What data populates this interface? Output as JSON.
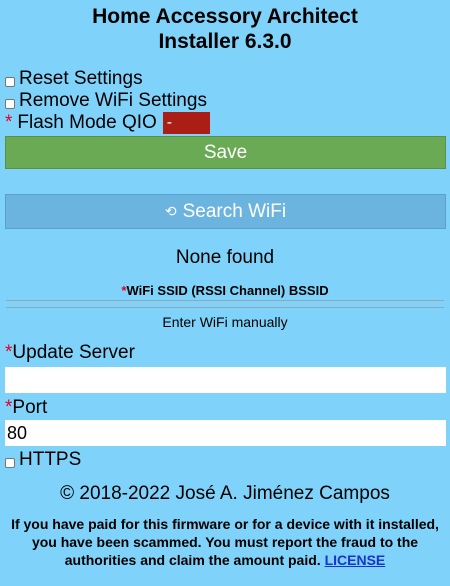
{
  "header": {
    "title_line1": "Home Accessory Architect",
    "title_line2": "Installer 6.3.0"
  },
  "options": {
    "reset_label": "Reset Settings",
    "remove_wifi_label": "Remove WiFi Settings",
    "flash_label": "Flash Mode QIO",
    "flash_value": "-",
    "required_mark": "*"
  },
  "buttons": {
    "save": "Save",
    "search_wifi": "Search WiFi"
  },
  "wifi": {
    "status": "None found",
    "table_header": "WiFi SSID (RSSI Channel) BSSID",
    "manual_link": "Enter WiFi manually"
  },
  "fields": {
    "update_server_label": "Update Server",
    "update_server_value": "",
    "port_label": "Port",
    "port_value": "80",
    "https_label": "HTTPS"
  },
  "footer": {
    "copyright": "© 2018-2022 José A. Jiménez Campos",
    "warning": "If you have paid for this firmware or for a device with it installed, you have been scammed. You must report the fraud to the authorities and claim the amount paid.",
    "license_link": "LICENSE"
  },
  "colors": {
    "background": "#7fd2f9",
    "save_button": "#6aaa54",
    "search_button": "#6bb4e0",
    "flash_select": "#aa1e15",
    "required": "#e4002b",
    "link": "#1a33cc"
  }
}
